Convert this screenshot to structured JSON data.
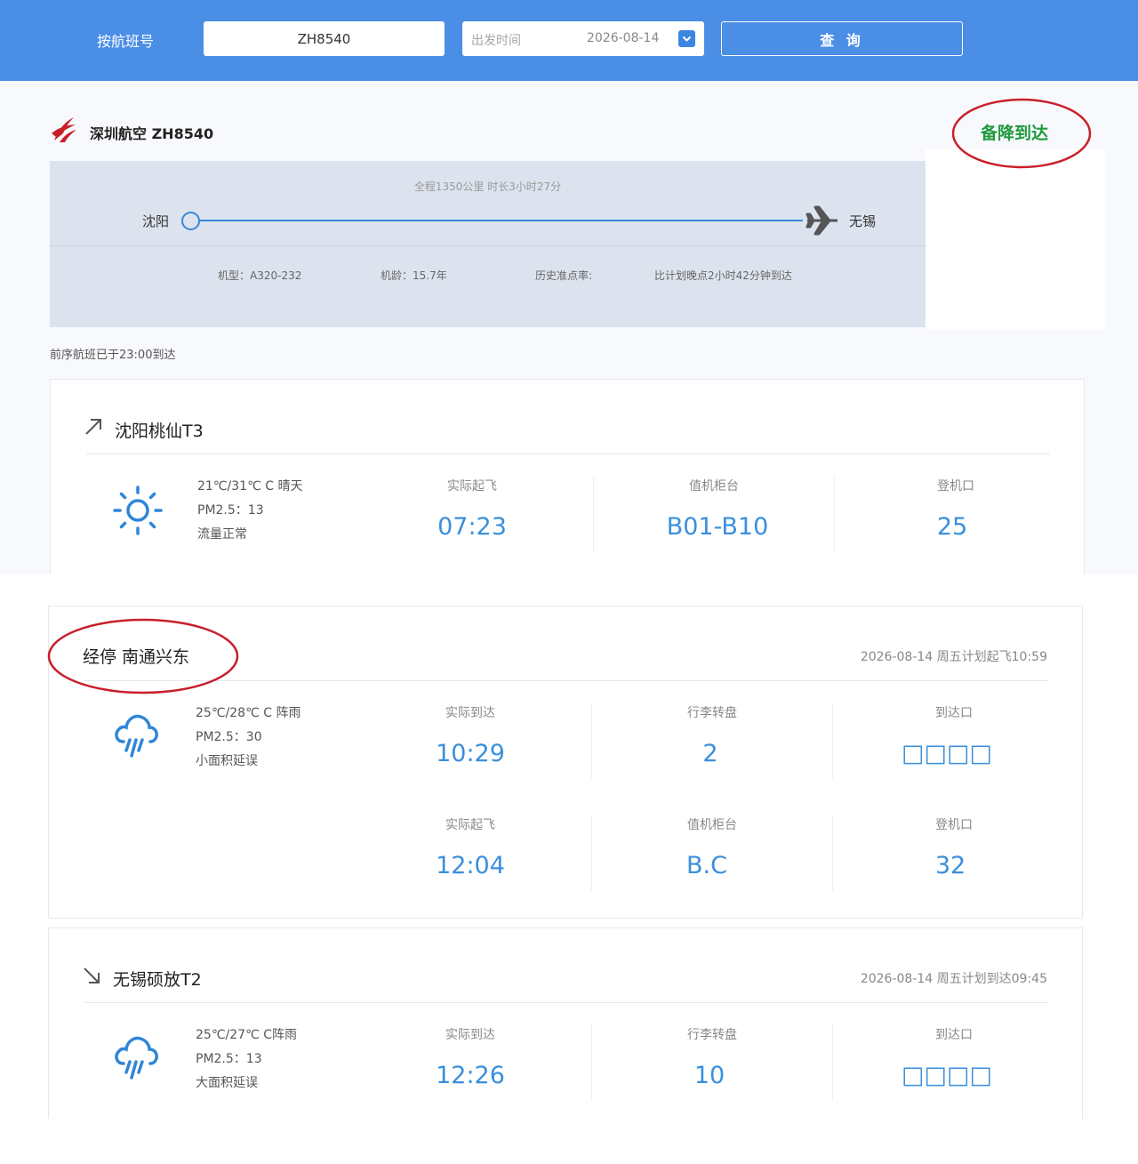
{
  "search": {
    "label": "按航班号",
    "flight_value": "ZH8540",
    "date_placeholder": "出发时间",
    "date_value": "2026-08-14",
    "query_label": "查 询"
  },
  "flight": {
    "title": "深圳航空 ZH8540",
    "status": "备降到达",
    "distance_duration": "全程1350公里 时长3小时27分",
    "departure_city": "沈阳",
    "arrival_city": "无锡",
    "aircraft_type": "机型：A320-232",
    "aircraft_age": "机龄：15.7年",
    "on_time_rate": "历史准点率:",
    "delay_note": "比计划晚点2小时42分钟到达",
    "previous_flight": "前序航班已于23:00到达"
  },
  "origin": {
    "name": "沈阳桃仙T3",
    "temp_weather": "21℃/31℃ C 晴天",
    "pm25": "PM2.5：13",
    "flow": "流量正常",
    "cols": [
      {
        "label": "实际起飞",
        "value": "07:23"
      },
      {
        "label": "值机柜台",
        "value": "B01-B10"
      },
      {
        "label": "登机口",
        "value": "25"
      }
    ]
  },
  "stopover": {
    "name": "经停 南通兴东",
    "date_info": "2026-08-14 周五计划起飞10:59",
    "temp_weather": "25℃/28℃ C 阵雨",
    "pm25": "PM2.5：30",
    "flow": "小面积延误",
    "row1": [
      {
        "label": "实际到达",
        "value": "10:29"
      },
      {
        "label": "行李转盘",
        "value": "2"
      },
      {
        "label": "到达口",
        "value": "□□□□"
      }
    ],
    "row2": [
      {
        "label": "实际起飞",
        "value": "12:04"
      },
      {
        "label": "值机柜台",
        "value": "B.C"
      },
      {
        "label": "登机口",
        "value": "32"
      }
    ]
  },
  "destination": {
    "name": "无锡硕放T2",
    "date_info": "2026-08-14 周五计划到达09:45",
    "temp_weather": "25℃/27℃ C阵雨",
    "pm25": "PM2.5：13",
    "flow": "大面积延误",
    "cols": [
      {
        "label": "实际到达",
        "value": "12:26"
      },
      {
        "label": "行李转盘",
        "value": "10"
      },
      {
        "label": "到达口",
        "value": "□□□□"
      }
    ]
  },
  "colors": {
    "topbar": "#4a8ee6",
    "accent_blue": "#3a8fdc",
    "status_green": "#1f9a3e",
    "annotation_red": "#c8202a"
  },
  "icons": [
    "airline-logo-icon",
    "plane-icon",
    "sun-icon",
    "rain-cloud-icon",
    "departure-arrow-icon",
    "arrival-arrow-icon",
    "dropdown-chevron-icon"
  ]
}
